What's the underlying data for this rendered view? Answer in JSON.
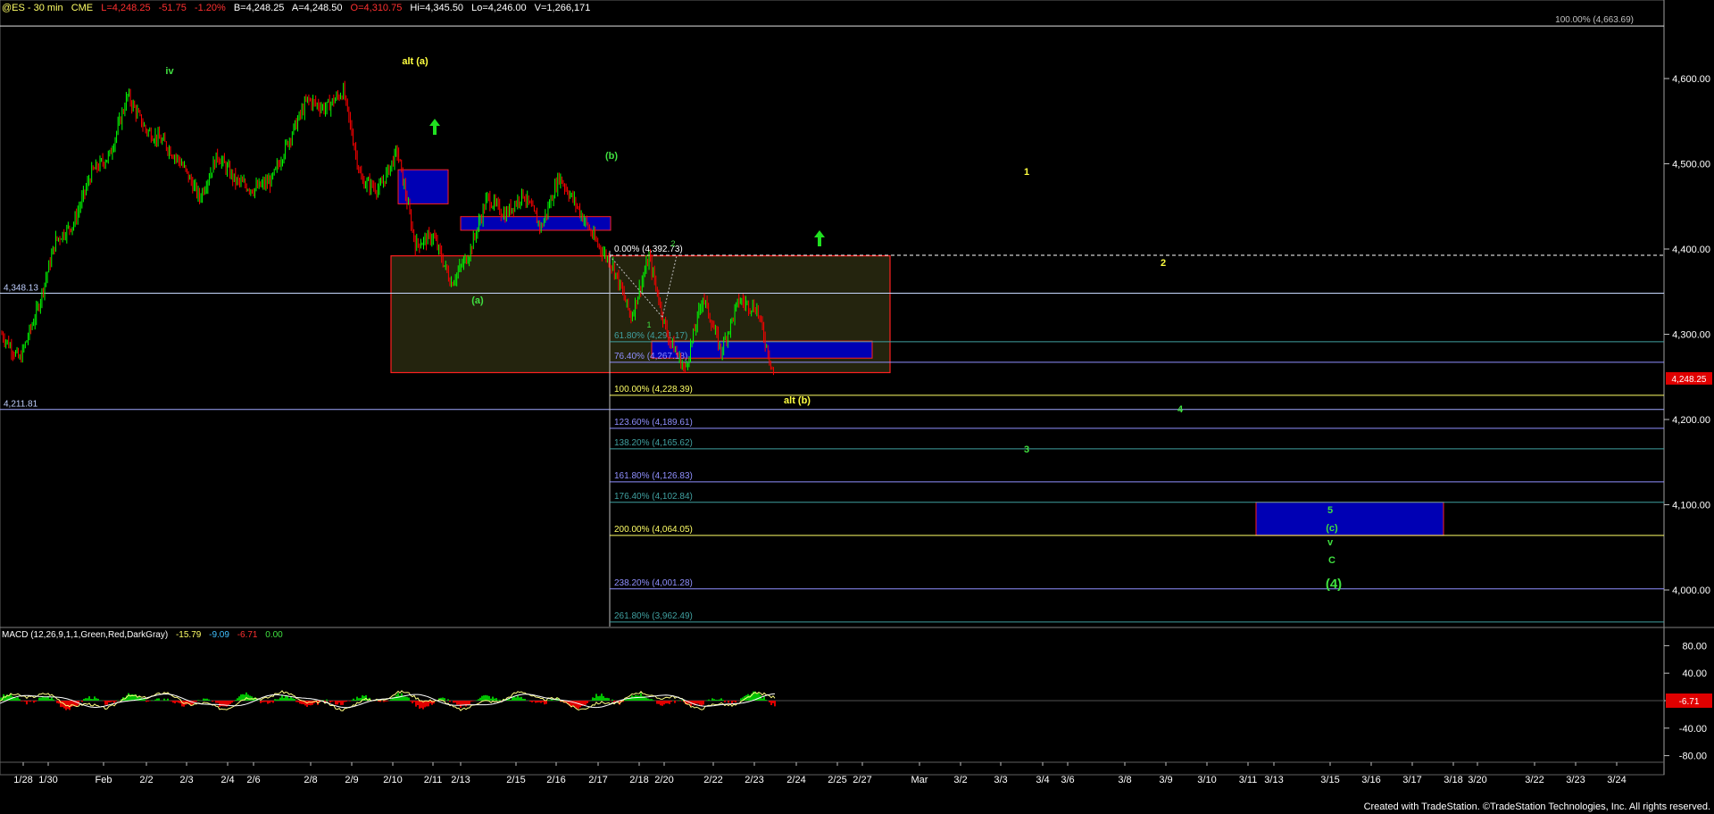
{
  "header": {
    "symbol": "@ES - 30 min",
    "exchange": "CME",
    "last": "L=4,248.25",
    "change": "-51.75",
    "change_pct": "-1.20%",
    "bid": "B=4,248.25",
    "ask": "A=4,248.50",
    "open": "O=4,310.75",
    "high": "Hi=4,345.50",
    "low": "Lo=4,246.00",
    "volume": "V=1,266,171"
  },
  "macd": {
    "title": "MACD (12,26,9,1,1,Green,Red,DarkGray)",
    "v1": "-15.79",
    "v2": "-9.09",
    "v3": "-6.71",
    "v4": "0.00",
    "current_tag": "-6.71",
    "axis_ticks": [
      "80.00",
      "40.00",
      "0.00",
      "-40.00",
      "-80.00"
    ]
  },
  "footer": {
    "credit": "Created with TradeStation. ©TradeStation Technologies, Inc. All rights reserved."
  },
  "colors": {
    "background": "#000000",
    "up_bar": "#00ff00",
    "down_bar": "#ff0000",
    "box_blue": "#0000b4",
    "box_border": "#ff2020",
    "fib_yellow": "#ffff66",
    "fib_blue": "#9090ff",
    "fib_teal": "#40a0a0",
    "label_green": "#40e040",
    "label_yellow": "#ffff40"
  },
  "chart_data": {
    "type": "candlestick",
    "title": "@ES - 30 min",
    "price_axis": {
      "ticks": [
        4600,
        4500,
        4400,
        4300,
        4200,
        4100,
        4000
      ],
      "tick_labels": [
        "4,600.00",
        "4,500.00",
        "4,400.00",
        "4,300.00",
        "4,200.00",
        "4,100.00",
        "4,000.00"
      ],
      "range": [
        3920,
        4680
      ]
    },
    "current_price_tag": "4,248.25",
    "date_axis_labels": [
      "1/28",
      "1/30",
      "Feb",
      "2/2",
      "2/3",
      "2/4",
      "2/6",
      "2/8",
      "2/9",
      "2/10",
      "2/11",
      "2/13",
      "2/15",
      "2/16",
      "2/17",
      "2/18",
      "2/20",
      "2/22",
      "2/23",
      "2/24",
      "2/25",
      "2/27",
      "Mar",
      "3/2",
      "3/3",
      "3/4",
      "3/6",
      "3/8",
      "3/9",
      "3/10",
      "3/11",
      "3/13",
      "3/15",
      "3/16",
      "3/17",
      "3/18",
      "3/20",
      "3/22",
      "3/23",
      "3/24"
    ],
    "price_path": [
      {
        "date": "1/27",
        "price": 4300
      },
      {
        "date": "1/28",
        "price": 4270
      },
      {
        "date": "1/29",
        "price": 4330
      },
      {
        "date": "1/30",
        "price": 4410
      },
      {
        "date": "1/31",
        "price": 4430
      },
      {
        "date": "Feb",
        "price": 4490
      },
      {
        "date": "2/1",
        "price": 4510
      },
      {
        "date": "2/2",
        "price": 4580
      },
      {
        "date": "2/2b",
        "price": 4540
      },
      {
        "date": "2/3",
        "price": 4525
      },
      {
        "date": "2/3b",
        "price": 4500
      },
      {
        "date": "2/4",
        "price": 4460
      },
      {
        "date": "2/4b",
        "price": 4510
      },
      {
        "date": "2/6",
        "price": 4480
      },
      {
        "date": "2/7",
        "price": 4470
      },
      {
        "date": "2/8",
        "price": 4480
      },
      {
        "date": "2/8b",
        "price": 4530
      },
      {
        "date": "2/9",
        "price": 4575
      },
      {
        "date": "2/9b",
        "price": 4565
      },
      {
        "date": "2/10",
        "price": 4585
      },
      {
        "date": "2/10b",
        "price": 4480
      },
      {
        "date": "2/11",
        "price": 4470
      },
      {
        "date": "2/11b",
        "price": 4515
      },
      {
        "date": "2/12",
        "price": 4405
      },
      {
        "date": "2/13",
        "price": 4415
      },
      {
        "date": "2/13b",
        "price": 4360
      },
      {
        "date": "2/14",
        "price": 4395
      },
      {
        "date": "2/15",
        "price": 4460
      },
      {
        "date": "2/15b",
        "price": 4440
      },
      {
        "date": "2/16",
        "price": 4465
      },
      {
        "date": "2/16b",
        "price": 4425
      },
      {
        "date": "2/17",
        "price": 4485
      },
      {
        "date": "2/17b",
        "price": 4450
      },
      {
        "date": "2/17c",
        "price": 4410
      },
      {
        "date": "2/18",
        "price": 4380
      },
      {
        "date": "2/18b",
        "price": 4320
      },
      {
        "date": "2/20",
        "price": 4390
      },
      {
        "date": "2/20b",
        "price": 4300
      },
      {
        "date": "2/21",
        "price": 4258
      },
      {
        "date": "2/22",
        "price": 4345
      },
      {
        "date": "2/22b",
        "price": 4280
      },
      {
        "date": "2/23",
        "price": 4340
      },
      {
        "date": "2/23b",
        "price": 4330
      },
      {
        "date": "2/23c",
        "price": 4248
      }
    ],
    "horizontal_levels": [
      {
        "price": 4663.69,
        "label": "100.00% (4,663.69)"
      },
      {
        "price": 4348.13,
        "label": "4,348.13"
      },
      {
        "price": 4211.81,
        "label": "4,211.81"
      }
    ],
    "fib_levels": [
      {
        "pct": "0.00%",
        "price": 4392.73,
        "label": "0.00% (4,392.73)"
      },
      {
        "pct": "61.80%",
        "price": 4291.17,
        "label": "61.80% (4,291.17)"
      },
      {
        "pct": "76.40%",
        "price": 4267.18,
        "label": "76.40% (4,267.18)"
      },
      {
        "pct": "100.00%",
        "price": 4228.39,
        "label": "100.00% (4,228.39)"
      },
      {
        "pct": "123.60%",
        "price": 4189.61,
        "label": "123.60% (4,189.61)"
      },
      {
        "pct": "138.20%",
        "price": 4165.62,
        "label": "138.20% (4,165.62)"
      },
      {
        "pct": "161.80%",
        "price": 4126.83,
        "label": "161.80% (4,126.83)"
      },
      {
        "pct": "176.40%",
        "price": 4102.84,
        "label": "176.40% (4,102.84)"
      },
      {
        "pct": "200.00%",
        "price": 4064.05,
        "label": "200.00% (4,064.05)"
      },
      {
        "pct": "238.20%",
        "price": 4001.28,
        "label": "238.20% (4,001.28)"
      },
      {
        "pct": "261.80%",
        "price": 3962.49,
        "label": "261.80% (3,962.49)"
      }
    ],
    "wave_labels": [
      "iv",
      "alt (a)",
      "(b)",
      "(a)",
      "alt (b)",
      "1",
      "2",
      "3",
      "4",
      "5",
      "(c)",
      "v",
      "C",
      "(4)"
    ],
    "macd_axis": {
      "range": [
        -100,
        100
      ],
      "ticks": [
        80,
        40,
        0,
        -40,
        -80
      ]
    }
  }
}
